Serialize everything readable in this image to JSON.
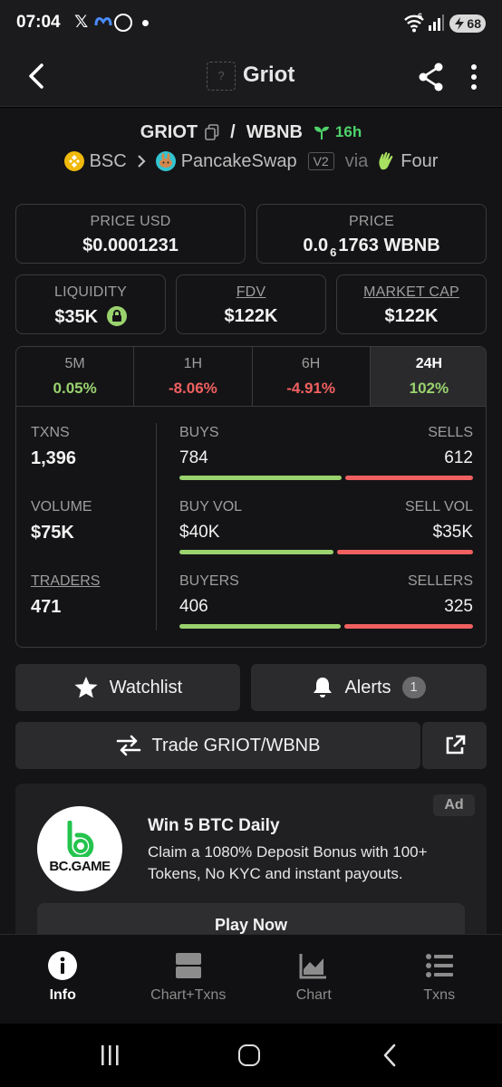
{
  "status_bar": {
    "time": "07:04",
    "x_logo": "𝕏",
    "wifi_label": "6",
    "battery": "68"
  },
  "header": {
    "token_logo_placeholder": "?",
    "title": "Griot"
  },
  "pair": {
    "base": "GRIOT",
    "separator": "/",
    "quote": "WBNB",
    "age": "16h"
  },
  "chain": {
    "network": "BSC",
    "dex": "PancakeSwap",
    "version": "V2",
    "via_label": "via",
    "launchpad": "Four"
  },
  "price": {
    "usd_label": "PRICE USD",
    "usd_value": "$0.0001231",
    "native_label": "PRICE",
    "native_prefix": "0.0",
    "native_subscript": "6",
    "native_value": "1763 WBNB"
  },
  "metrics": {
    "liquidity_label": "LIQUIDITY",
    "liquidity_value": "$35K",
    "fdv_label": "FDV",
    "fdv_value": "$122K",
    "mcap_label": "MARKET CAP",
    "mcap_value": "$122K"
  },
  "timeframes": [
    {
      "label": "5M",
      "value": "0.05%",
      "trend": "up"
    },
    {
      "label": "1H",
      "value": "-8.06%",
      "trend": "down"
    },
    {
      "label": "6H",
      "value": "-4.91%",
      "trend": "down"
    },
    {
      "label": "24H",
      "value": "102%",
      "trend": "up",
      "active": true
    }
  ],
  "stats": {
    "txns_label": "TXNS",
    "txns_value": "1,396",
    "volume_label": "VOLUME",
    "volume_value": "$75K",
    "traders_label": "TRADERS",
    "traders_value": "471",
    "buys_label": "BUYS",
    "buys_value": "784",
    "sells_label": "SELLS",
    "sells_value": "612",
    "buy_vol_label": "BUY VOL",
    "buy_vol_value": "$40K",
    "sell_vol_label": "SELL VOL",
    "sell_vol_value": "$35K",
    "buyers_label": "BUYERS",
    "buyers_value": "406",
    "sellers_label": "SELLERS",
    "sellers_value": "325",
    "buy_ratio": 0.56,
    "buy_vol_ratio": 0.53,
    "buyers_ratio": 0.555
  },
  "actions": {
    "watchlist_label": "Watchlist",
    "alerts_label": "Alerts",
    "alerts_count": "1",
    "trade_label": "Trade GRIOT/WBNB"
  },
  "ad": {
    "badge": "Ad",
    "brand": "BC.GAME",
    "title": "Win 5 BTC Daily",
    "text": "Claim a 1080% Deposit Bonus with 100+ Tokens, No KYC and instant payouts.",
    "cta": "Play Now"
  },
  "bottom_nav": [
    {
      "label": "Info",
      "icon": "info-icon",
      "active": true
    },
    {
      "label": "Chart+Txns",
      "icon": "chart-txns-icon"
    },
    {
      "label": "Chart",
      "icon": "chart-icon"
    },
    {
      "label": "Txns",
      "icon": "list-icon"
    }
  ],
  "colors": {
    "positive": "#9ad26e",
    "negative": "#f06060",
    "age": "#4ed26a",
    "background": "#141416"
  }
}
